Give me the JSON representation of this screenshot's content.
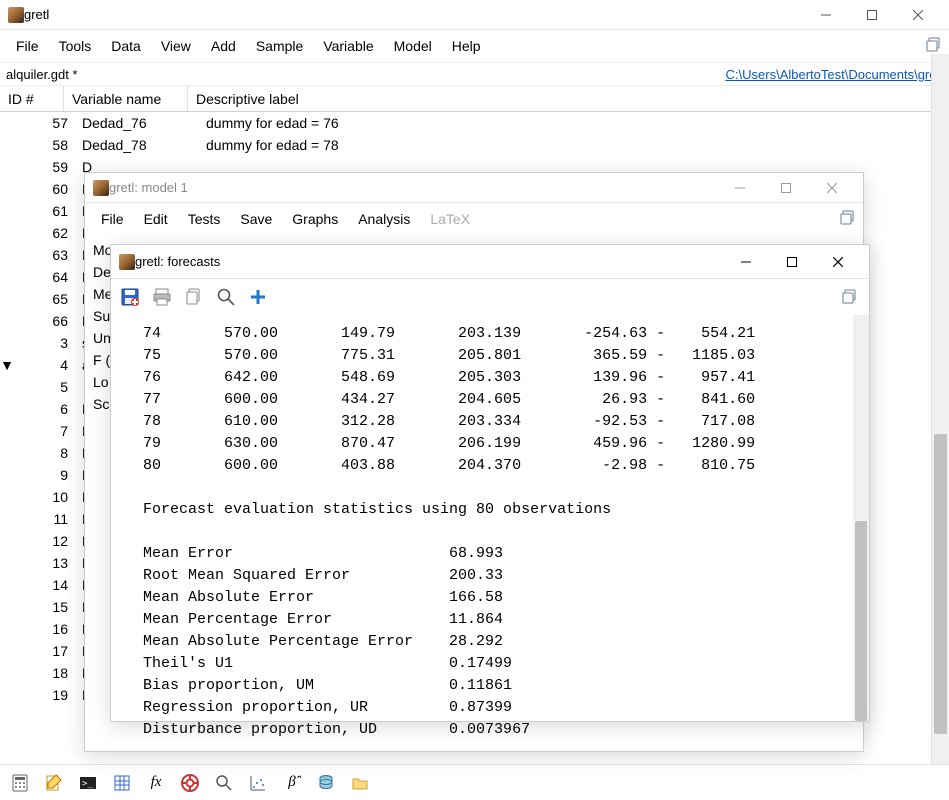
{
  "main": {
    "title": "gretl",
    "menubar": [
      "File",
      "Tools",
      "Data",
      "View",
      "Add",
      "Sample",
      "Variable",
      "Model",
      "Help"
    ],
    "file_label": "alquiler.gdt *",
    "path_label": "C:\\Users\\AlbertoTest\\Documents\\gretl",
    "headers": {
      "id": "ID #",
      "name": "Variable name",
      "desc": "Descriptive label"
    },
    "rows": [
      {
        "id": "57",
        "name": "Dedad_76",
        "desc": "dummy for edad = 76"
      },
      {
        "id": "58",
        "name": "Dedad_78",
        "desc": "dummy for edad = 78"
      },
      {
        "id": "59",
        "name": "D",
        "desc": ""
      },
      {
        "id": "60",
        "name": "D",
        "desc": ""
      },
      {
        "id": "61",
        "name": "D",
        "desc": ""
      },
      {
        "id": "62",
        "name": "D",
        "desc": ""
      },
      {
        "id": "63",
        "name": "D",
        "desc": ""
      },
      {
        "id": "64",
        "name": "D",
        "desc": ""
      },
      {
        "id": "65",
        "name": "D",
        "desc": ""
      },
      {
        "id": "66",
        "name": "D",
        "desc": ""
      },
      {
        "id": "3",
        "name": "s",
        "desc": "",
        "marker": ""
      },
      {
        "id": "4",
        "name": "a",
        "desc": "",
        "marker": "▼"
      },
      {
        "id": "5",
        "name": "",
        "desc": ""
      },
      {
        "id": "6",
        "name": "D",
        "desc": ""
      },
      {
        "id": "7",
        "name": "D",
        "desc": ""
      },
      {
        "id": "8",
        "name": "D",
        "desc": ""
      },
      {
        "id": "9",
        "name": "D",
        "desc": ""
      },
      {
        "id": "10",
        "name": "D",
        "desc": ""
      },
      {
        "id": "11",
        "name": "D",
        "desc": ""
      },
      {
        "id": "12",
        "name": "D",
        "desc": ""
      },
      {
        "id": "13",
        "name": "D",
        "desc": ""
      },
      {
        "id": "14",
        "name": "D",
        "desc": ""
      },
      {
        "id": "15",
        "name": "D",
        "desc": ""
      },
      {
        "id": "16",
        "name": "D",
        "desc": ""
      },
      {
        "id": "17",
        "name": "D",
        "desc": ""
      },
      {
        "id": "18",
        "name": "D",
        "desc": ""
      },
      {
        "id": "19",
        "name": "D",
        "desc": ""
      }
    ]
  },
  "model": {
    "title": "gretl: model 1",
    "menubar": [
      "File",
      "Edit",
      "Tests",
      "Save",
      "Graphs",
      "Analysis",
      "LaTeX"
    ],
    "side_labels": [
      "Mo",
      "De",
      "",
      "",
      "",
      "",
      "",
      "",
      "Me",
      "Su",
      "Un",
      "F (",
      "Lo",
      "Sc"
    ]
  },
  "forecast": {
    "title": "gretl: forecasts",
    "table": [
      {
        "obs": "74",
        "actual": "570.00",
        "pred": "149.79",
        "se": "203.139",
        "lo": "-254.63",
        "hi": "554.21"
      },
      {
        "obs": "75",
        "actual": "570.00",
        "pred": "775.31",
        "se": "205.801",
        "lo": "365.59",
        "hi": "1185.03"
      },
      {
        "obs": "76",
        "actual": "642.00",
        "pred": "548.69",
        "se": "205.303",
        "lo": "139.96",
        "hi": "957.41"
      },
      {
        "obs": "77",
        "actual": "600.00",
        "pred": "434.27",
        "se": "204.605",
        "lo": "26.93",
        "hi": "841.60"
      },
      {
        "obs": "78",
        "actual": "610.00",
        "pred": "312.28",
        "se": "203.334",
        "lo": "-92.53",
        "hi": "717.08"
      },
      {
        "obs": "79",
        "actual": "630.00",
        "pred": "870.47",
        "se": "206.199",
        "lo": "459.96",
        "hi": "1280.99"
      },
      {
        "obs": "80",
        "actual": "600.00",
        "pred": "403.88",
        "se": "204.370",
        "lo": "-2.98",
        "hi": "810.75"
      }
    ],
    "stats_heading": "Forecast evaluation statistics using 80 observations",
    "stats": [
      {
        "label": "Mean Error",
        "value": "68.993"
      },
      {
        "label": "Root Mean Squared Error",
        "value": "200.33"
      },
      {
        "label": "Mean Absolute Error",
        "value": "166.58"
      },
      {
        "label": "Mean Percentage Error",
        "value": "11.864"
      },
      {
        "label": "Mean Absolute Percentage Error",
        "value": "28.292"
      },
      {
        "label": "Theil's U1",
        "value": "0.17499"
      },
      {
        "label": "Bias proportion, UM",
        "value": "0.11861"
      },
      {
        "label": "Regression proportion, UR",
        "value": "0.87399"
      },
      {
        "label": "Disturbance proportion, UD",
        "value": "0.0073967"
      }
    ]
  }
}
